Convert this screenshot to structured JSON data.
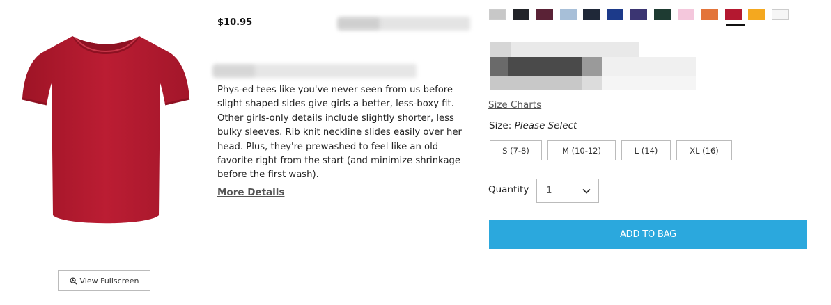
{
  "product": {
    "price": "$10.95",
    "description": "Phys-ed tees like you've never seen from us before – slight shaped sides give girls a better, less-boxy fit. Other girls-only details include slightly shorter, less bulky sleeves. Rib knit neckline slides easily over her head. Plus, they're prewashed to feel like an old favorite right from the start (and minimize shrinkage before the first wash).",
    "more_details": "More Details",
    "image_icon": "red-tshirt-image",
    "image_color": "#b4182e"
  },
  "gallery": {
    "fullscreen_label": "View Fullscreen",
    "fullscreen_icon": "zoom-in-icon"
  },
  "colors": {
    "selected_index": 10,
    "swatches": [
      "#c8c8c8",
      "#222429",
      "#5a2236",
      "#a7bfd8",
      "#1f2838",
      "#1c3a8a",
      "#3b3572",
      "#1e3b32",
      "#f4c7dc",
      "#e3743a",
      "#b41830",
      "#f4a81f",
      "#f6f6f6"
    ]
  },
  "sizing": {
    "size_charts_label": "Size Charts",
    "size_label": "Size:",
    "size_prompt": "Please Select",
    "options": [
      "S (7-8)",
      "M (10-12)",
      "L (14)",
      "XL (16)"
    ]
  },
  "quantity": {
    "label": "Quantity",
    "value": "1",
    "chevron_icon": "chevron-down-icon"
  },
  "cart": {
    "add_label": "ADD TO BAG"
  }
}
